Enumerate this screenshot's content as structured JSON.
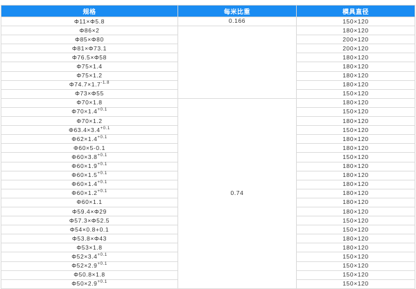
{
  "table": {
    "headers": [
      "规格",
      "每米比重",
      "模具直径"
    ],
    "groups": [
      {
        "weight": "0.166",
        "row_count": 1
      },
      {
        "weight": "",
        "row_count": 8
      },
      {
        "weight": "0.74",
        "row_count": 21
      }
    ],
    "rows": [
      {
        "spec": "Φ11×Φ5.8",
        "die": "150×120"
      },
      {
        "spec": "Φ86×2",
        "die": "180×120"
      },
      {
        "spec": "Φ85×Φ80",
        "die": "200×120"
      },
      {
        "spec": "Φ81×Φ73.1",
        "die": "200×120"
      },
      {
        "spec": "Φ76.5×Φ58",
        "die": "180×120"
      },
      {
        "spec": "Φ75×1.4",
        "die": "180×120"
      },
      {
        "spec": "Φ75×1.2",
        "die": "180×120"
      },
      {
        "spec": "Φ74.7×1.7",
        "sup": "-1.8",
        "die": "180×120"
      },
      {
        "spec": "Φ73×Φ55",
        "die": "150×120"
      },
      {
        "spec": "Φ70×1.8",
        "die": "180×120"
      },
      {
        "spec": "Φ70×1.4",
        "sup": "+0.1",
        "die": "150×120"
      },
      {
        "spec": "Φ70×1.2",
        "die": "180×120"
      },
      {
        "spec": "Φ63.4×3.4",
        "sup": "+0.1",
        "die": "150×120"
      },
      {
        "spec": "Φ62×1.4",
        "sup": "+0.1",
        "die": "180×120"
      },
      {
        "spec": "Φ60×5-0.1",
        "die": "180×120"
      },
      {
        "spec": "Φ60×3.8",
        "sup": "+0.1",
        "die": "150×120"
      },
      {
        "spec": "Φ60×1.9",
        "sup": "+0.1",
        "die": "180×120"
      },
      {
        "spec": "Φ60×1.5",
        "sup": "+0.1",
        "die": "180×120"
      },
      {
        "spec": "Φ60×1.4",
        "sup": "+0.1",
        "die": "180×120"
      },
      {
        "spec": "Φ60×1.2",
        "sup": "+0.1",
        "die": "180×120"
      },
      {
        "spec": "Φ60×1.1",
        "die": "180×120"
      },
      {
        "spec": "Φ59.4×Φ29",
        "die": "180×120"
      },
      {
        "spec": "Φ57.3×Φ52.5",
        "die": "150×120"
      },
      {
        "spec": "Φ54×0.8+0.1",
        "die": "150×120"
      },
      {
        "spec": "Φ53.8×Φ43",
        "die": "180×120"
      },
      {
        "spec": "Φ53×1.8",
        "die": "180×120"
      },
      {
        "spec": "Φ52×3.4",
        "sup": "+0.1",
        "die": "150×120"
      },
      {
        "spec": "Φ52×2.9",
        "sup": "+0.1",
        "die": "150×120"
      },
      {
        "spec": "Φ50.8×1.8",
        "die": "150×120"
      },
      {
        "spec": "Φ50×2.9",
        "sup": "+0.1",
        "die": "150×120"
      }
    ]
  },
  "colors": {
    "header_bg": "#1a8cf2",
    "header_text": "#ffffff",
    "cell_text": "#333333",
    "border": "#d9d9d9"
  }
}
